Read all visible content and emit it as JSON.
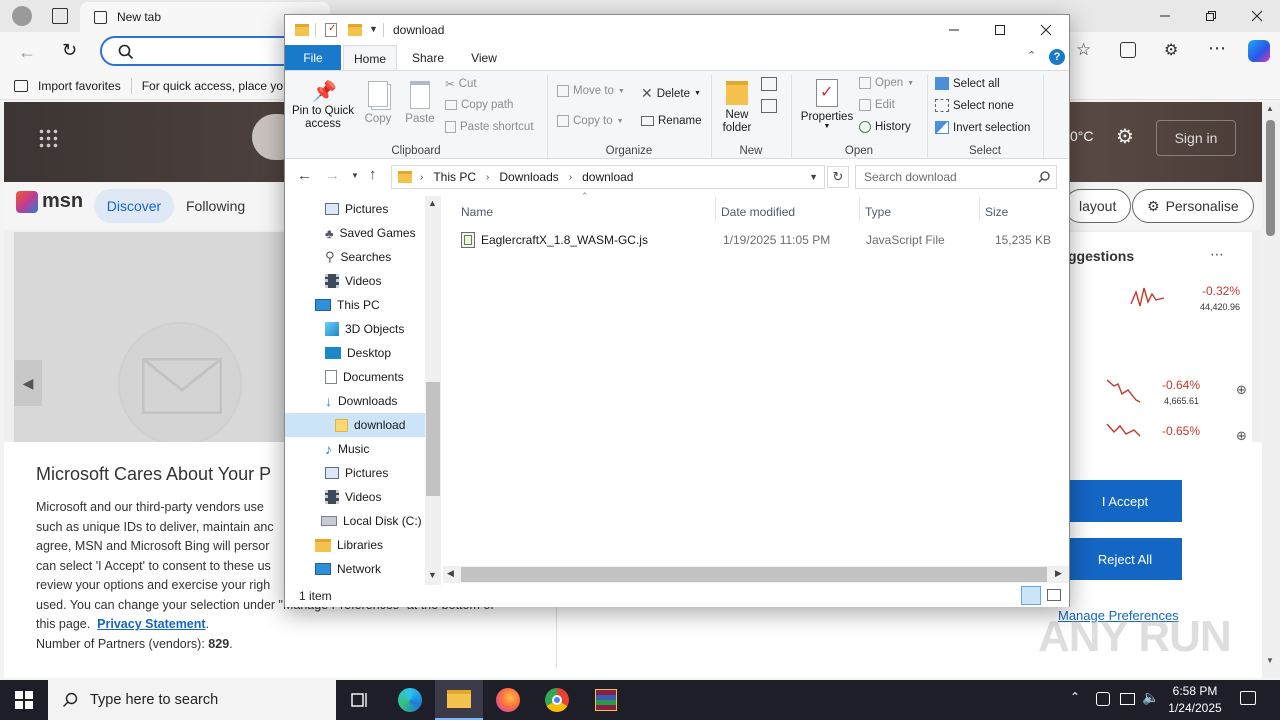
{
  "browser": {
    "tab_title": "New tab",
    "favbar": {
      "import": "Import favorites",
      "hint": "For quick access, place yo"
    },
    "msn": {
      "brand": "msn",
      "nav": {
        "discover": "Discover",
        "following": "Following",
        "layout": "layout",
        "personalise": "Personalise"
      },
      "sign_in": "Sign in",
      "temp": "0°C",
      "suggestions": "ggestions",
      "stocks": [
        {
          "change": "-0.32%",
          "value": "44,420.96"
        },
        {
          "change": "-0.64%",
          "value": "4,665.61"
        },
        {
          "change": "-0.65%",
          "value": ""
        }
      ]
    },
    "consent": {
      "title": "Microsoft Cares About Your P",
      "lines": [
        "Microsoft and our third-party vendors use",
        "such as unique IDs to deliver, maintain anc",
        "agree, MSN and Microsoft Bing will persor",
        "can select 'I Accept' to consent to these us",
        "review your options and exercise your righ",
        "used.  You can change your selection under \"Manage Preferences\" at the bottom of"
      ],
      "this_page": "this page.",
      "privacy_link": "Privacy Statement",
      "partners_label": "Number of Partners (vendors):",
      "partners_count": "829",
      "accept": "I Accept",
      "reject": "Reject All",
      "manage": "Manage Preferences"
    },
    "watermark": "ANY RUN"
  },
  "explorer": {
    "title": "download",
    "tabs": {
      "file": "File",
      "home": "Home",
      "share": "Share",
      "view": "View"
    },
    "ribbon": {
      "clipboard": {
        "label": "Clipboard",
        "pin": "Pin to Quick access",
        "copy": "Copy",
        "paste": "Paste",
        "cut": "Cut",
        "copy_path": "Copy path",
        "paste_shortcut": "Paste shortcut"
      },
      "organize": {
        "label": "Organize",
        "move_to": "Move to",
        "copy_to": "Copy to",
        "delete": "Delete",
        "rename": "Rename"
      },
      "new": {
        "label": "New",
        "new_folder_1": "New",
        "new_folder_2": "folder"
      },
      "open": {
        "label": "Open",
        "properties": "Properties",
        "open": "Open",
        "edit": "Edit",
        "history": "History"
      },
      "select": {
        "label": "Select",
        "all": "Select all",
        "none": "Select none",
        "invert": "Invert selection"
      }
    },
    "path": [
      "This PC",
      "Downloads",
      "download"
    ],
    "search_placeholder": "Search download",
    "nav": [
      {
        "label": "Pictures",
        "icon": "pictures-icon"
      },
      {
        "label": "Saved Games",
        "icon": "saved-games-icon"
      },
      {
        "label": "Searches",
        "icon": "searches-icon"
      },
      {
        "label": "Videos",
        "icon": "videos-icon"
      },
      {
        "label": "This PC",
        "icon": "this-pc-icon"
      },
      {
        "label": "3D Objects",
        "icon": "3d-objects-icon"
      },
      {
        "label": "Desktop",
        "icon": "desktop-icon"
      },
      {
        "label": "Documents",
        "icon": "documents-icon"
      },
      {
        "label": "Downloads",
        "icon": "downloads-icon"
      },
      {
        "label": "download",
        "icon": "folder-icon"
      },
      {
        "label": "Music",
        "icon": "music-icon"
      },
      {
        "label": "Pictures",
        "icon": "pictures-icon"
      },
      {
        "label": "Videos",
        "icon": "videos-icon"
      },
      {
        "label": "Local Disk (C:)",
        "icon": "drive-icon"
      },
      {
        "label": "Libraries",
        "icon": "libraries-icon"
      },
      {
        "label": "Network",
        "icon": "network-icon"
      }
    ],
    "columns": {
      "name": "Name",
      "date": "Date modified",
      "type": "Type",
      "size": "Size"
    },
    "files": [
      {
        "name": "EaglercraftX_1.8_WASM-GC.js",
        "date": "1/19/2025 11:05 PM",
        "type": "JavaScript File",
        "size": "15,235 KB"
      }
    ],
    "status": "1 item"
  },
  "taskbar": {
    "search_placeholder": "Type here to search",
    "time": "6:58 PM",
    "date": "1/24/2025"
  }
}
